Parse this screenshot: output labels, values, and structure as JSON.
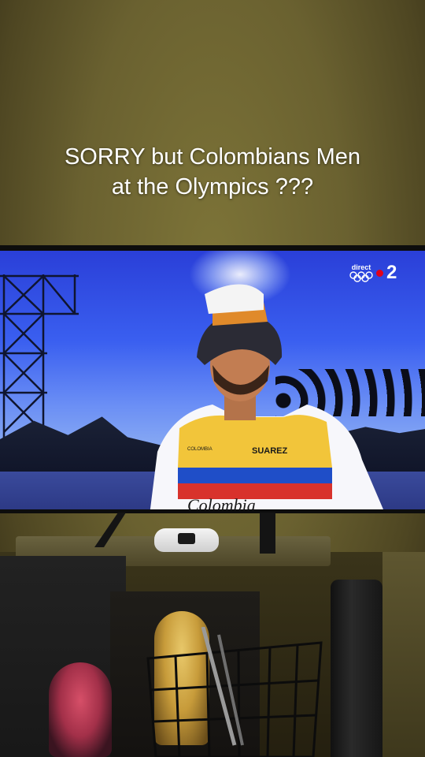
{
  "caption": {
    "line1": "SORRY but Colombians Men",
    "line2": "at the Olympics ???"
  },
  "tv": {
    "broadcast_label": "direct",
    "channel_number": "2",
    "jersey_name": "SUAREZ",
    "jersey_team_text": "Colombia",
    "jersey_small_text": "COLOMBIA"
  },
  "colors": {
    "wall": "#6b6230",
    "sky_top": "#2a3fd8",
    "jersey_yellow": "#f2c53a",
    "jersey_blue": "#1f4ec8",
    "jersey_red": "#d8322c",
    "channel_red": "#e1001a"
  },
  "icons": {
    "olympic_rings": "olympic-rings-icon",
    "channel_dot": "france2-dot-icon"
  }
}
